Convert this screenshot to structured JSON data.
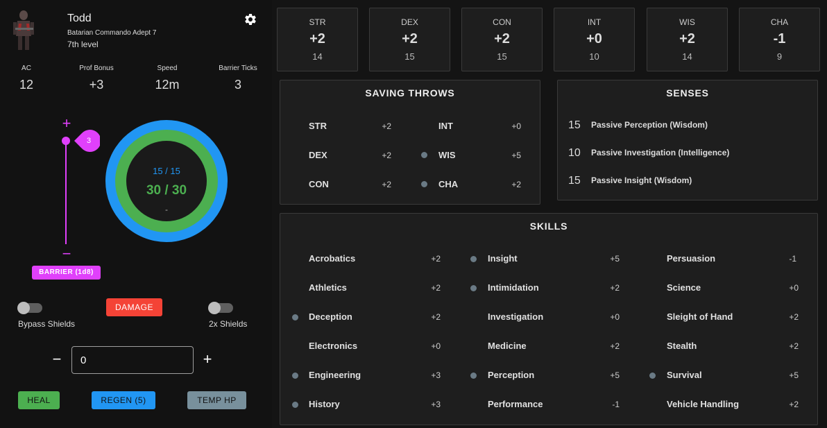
{
  "character": {
    "name": "Todd",
    "subtitle": "Batarian Commando Adept 7",
    "level": "7th level"
  },
  "stats": [
    {
      "label": "AC",
      "value": "12"
    },
    {
      "label": "Prof Bonus",
      "value": "+3"
    },
    {
      "label": "Speed",
      "value": "12m"
    },
    {
      "label": "Barrier Ticks",
      "value": "3"
    }
  ],
  "barrier": {
    "plus": "+",
    "minus": "−",
    "slider_value": "3",
    "slider_level": 1.0,
    "button_label": "BARRIER (1d8)"
  },
  "health": {
    "shields": "15 / 15",
    "hp": "30 / 30",
    "temp": "-"
  },
  "controls": {
    "bypass_label": "Bypass Shields",
    "double_label": "2x Shields",
    "damage_label": "DAMAGE",
    "minus": "−",
    "plus": "+",
    "amount_value": "0",
    "heal_label": "HEAL",
    "regen_label": "REGEN (5)",
    "temp_label": "TEMP HP"
  },
  "abilities": [
    {
      "name": "STR",
      "mod": "+2",
      "score": "14"
    },
    {
      "name": "DEX",
      "mod": "+2",
      "score": "15"
    },
    {
      "name": "CON",
      "mod": "+2",
      "score": "15"
    },
    {
      "name": "INT",
      "mod": "+0",
      "score": "10"
    },
    {
      "name": "WIS",
      "mod": "+2",
      "score": "14"
    },
    {
      "name": "CHA",
      "mod": "-1",
      "score": "9"
    }
  ],
  "saving_throws": {
    "title": "SAVING THROWS",
    "items": [
      {
        "name": "STR",
        "value": "+2",
        "proficient": false
      },
      {
        "name": "DEX",
        "value": "+2",
        "proficient": false
      },
      {
        "name": "CON",
        "value": "+2",
        "proficient": false
      },
      {
        "name": "INT",
        "value": "+0",
        "proficient": false
      },
      {
        "name": "WIS",
        "value": "+5",
        "proficient": true
      },
      {
        "name": "CHA",
        "value": "+2",
        "proficient": true
      }
    ]
  },
  "senses": {
    "title": "SENSES",
    "items": [
      {
        "value": "15",
        "name": "Passive Perception (Wisdom)"
      },
      {
        "value": "10",
        "name": "Passive Investigation (Intelligence)"
      },
      {
        "value": "15",
        "name": "Passive Insight (Wisdom)"
      }
    ]
  },
  "skills": {
    "title": "SKILLS",
    "items": [
      {
        "name": "Acrobatics",
        "value": "+2",
        "proficient": false
      },
      {
        "name": "Athletics",
        "value": "+2",
        "proficient": false
      },
      {
        "name": "Deception",
        "value": "+2",
        "proficient": true
      },
      {
        "name": "Electronics",
        "value": "+0",
        "proficient": false
      },
      {
        "name": "Engineering",
        "value": "+3",
        "proficient": true
      },
      {
        "name": "History",
        "value": "+3",
        "proficient": true
      },
      {
        "name": "Insight",
        "value": "+5",
        "proficient": true
      },
      {
        "name": "Intimidation",
        "value": "+2",
        "proficient": true
      },
      {
        "name": "Investigation",
        "value": "+0",
        "proficient": false
      },
      {
        "name": "Medicine",
        "value": "+2",
        "proficient": false
      },
      {
        "name": "Perception",
        "value": "+5",
        "proficient": true
      },
      {
        "name": "Performance",
        "value": "-1",
        "proficient": false
      },
      {
        "name": "Persuasion",
        "value": "-1",
        "proficient": false
      },
      {
        "name": "Science",
        "value": "+0",
        "proficient": false
      },
      {
        "name": "Sleight of Hand",
        "value": "+2",
        "proficient": false
      },
      {
        "name": "Stealth",
        "value": "+2",
        "proficient": false
      },
      {
        "name": "Survival",
        "value": "+5",
        "proficient": true
      },
      {
        "name": "Vehicle Handling",
        "value": "+2",
        "proficient": false
      }
    ]
  },
  "colors": {
    "barrier": "#e040fb",
    "shields": "#2196f3",
    "hp": "#4caf50",
    "damage": "#f44336",
    "temp": "#78909c"
  },
  "icons": {
    "settings": "gear-icon",
    "avatar": "character-portrait"
  }
}
